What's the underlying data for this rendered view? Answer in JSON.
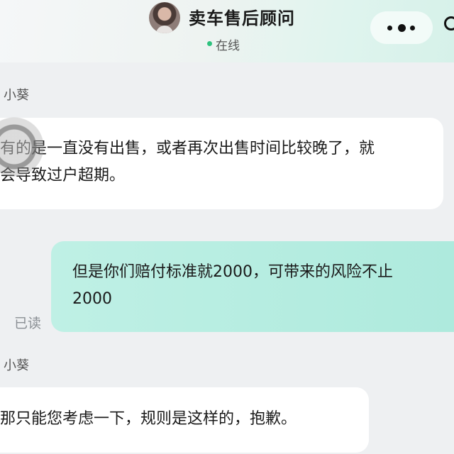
{
  "header": {
    "title": "卖车售后顾问",
    "status": "在线"
  },
  "messages": [
    {
      "sender": "小葵",
      "lines": [
        "有的是一直没有出售，或者再次出售时间比较晚了，就",
        "会导致过户超期。"
      ]
    },
    {
      "lines": [
        "但是你们赔付标准就2000，可带来的风险不止",
        "2000"
      ],
      "read_status": "已读"
    },
    {
      "sender": "小葵",
      "lines": [
        "那只能您考虑一下，规则是这样的，抱歉。"
      ]
    }
  ],
  "icons": {
    "menu": "more-dots-icon",
    "close": "close-circle-icon",
    "status": "online-dot-icon"
  },
  "colors": {
    "outgoing_bubble": "#b6ede1",
    "online": "#2ec27e",
    "background": "#eef0f2"
  }
}
